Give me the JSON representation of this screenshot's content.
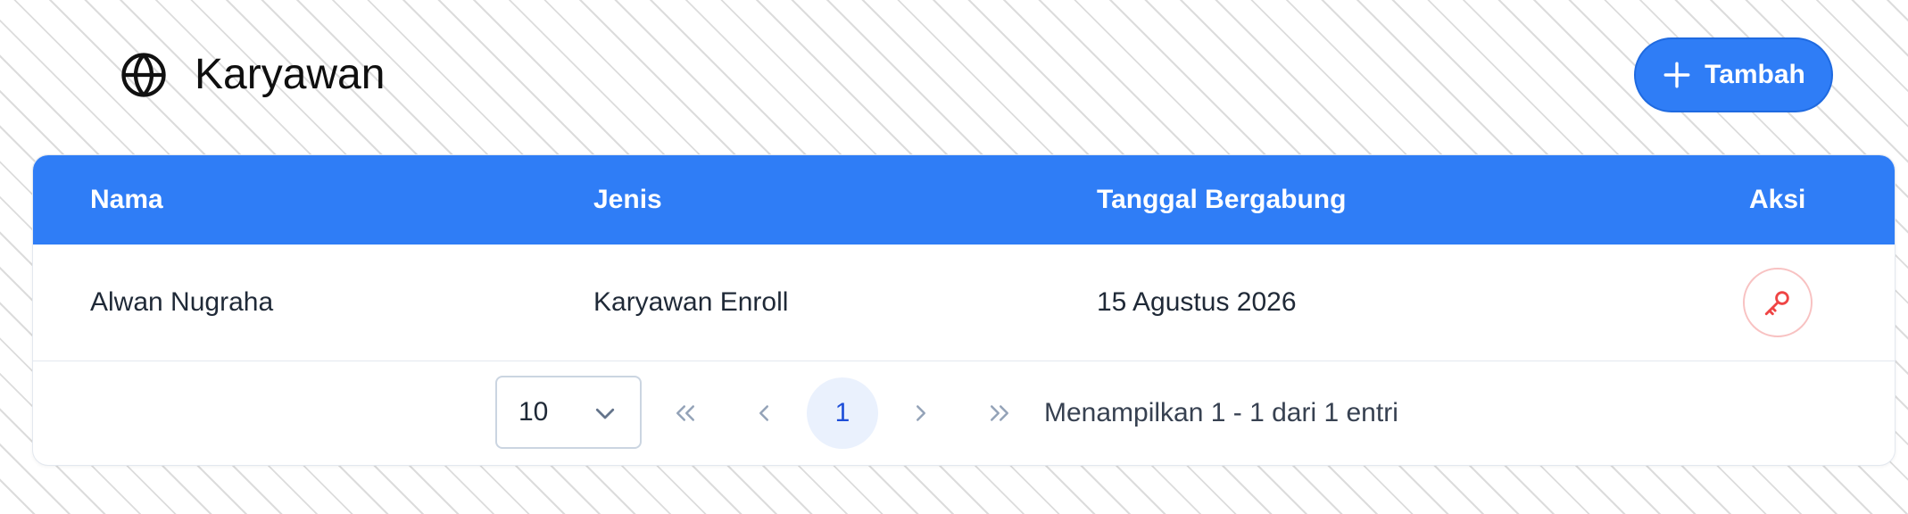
{
  "header": {
    "title": "Karyawan",
    "icon": "globe-icon",
    "add_label": "Tambah"
  },
  "table": {
    "columns": [
      "Nama",
      "Jenis",
      "Tanggal Bergabung",
      "Aksi"
    ],
    "rows": [
      {
        "nama": "Alwan Nugraha",
        "jenis": "Karyawan Enroll",
        "tanggal": "15 Agustus 2026",
        "action_icon": "key-icon"
      }
    ]
  },
  "pagination": {
    "page_size": "10",
    "current_page": "1",
    "info": "Menampilkan 1 - 1 dari 1 entri"
  },
  "colors": {
    "primary": "#2f7df6",
    "danger": "#ef4444",
    "page_active_bg": "#eaf1fd"
  }
}
